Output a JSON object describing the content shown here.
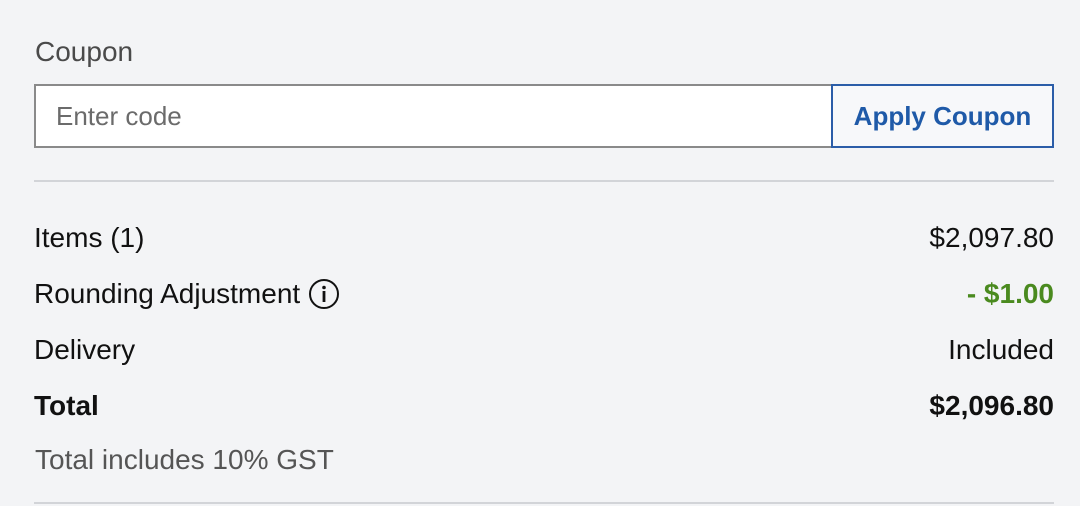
{
  "coupon": {
    "label": "Coupon",
    "input_placeholder": "Enter code",
    "input_value": "",
    "apply_label": "Apply Coupon"
  },
  "summary": {
    "rows": [
      {
        "label": "Items (1)",
        "value": "$2,097.80"
      },
      {
        "label": "Rounding Adjustment",
        "value": "- $1.00",
        "has_info_icon": true,
        "icon": "info-icon"
      },
      {
        "label": "Delivery",
        "value": "Included"
      }
    ],
    "total": {
      "label": "Total",
      "value": "$2,096.80"
    },
    "gst_note": "Total includes 10% GST"
  },
  "colors": {
    "background": "#f3f4f6",
    "accent": "#1f5aa8",
    "discount_green": "#4a8a1f",
    "divider": "#d2d4d8"
  }
}
